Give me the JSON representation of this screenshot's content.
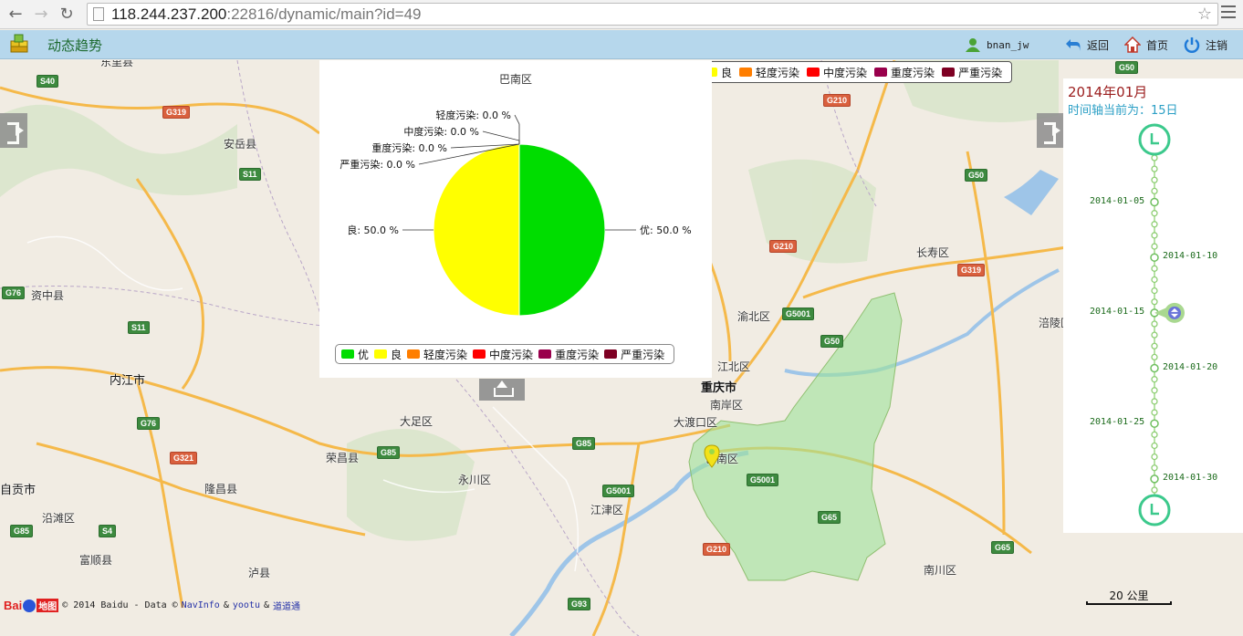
{
  "browser": {
    "url_host": "118.244.237.200",
    "url_rest": ":22816/dynamic/main?id=49"
  },
  "header": {
    "title": "动态趋势",
    "user": "bnan_jw",
    "back_label": "返回",
    "home_label": "首页",
    "logout_label": "注销"
  },
  "map": {
    "labels": [
      {
        "text": "东里县",
        "kind": "small"
      },
      {
        "text": "安岳县",
        "kind": "small"
      },
      {
        "text": "资中县",
        "kind": "small"
      },
      {
        "text": "内江市",
        "kind": "city"
      },
      {
        "text": "自贡市",
        "kind": "city"
      },
      {
        "text": "沿滩区",
        "kind": "small"
      },
      {
        "text": "富顺县",
        "kind": "small"
      },
      {
        "text": "隆昌县",
        "kind": "small"
      },
      {
        "text": "泸县",
        "kind": "small"
      },
      {
        "text": "大足区",
        "kind": "small"
      },
      {
        "text": "荣昌县",
        "kind": "small"
      },
      {
        "text": "永川区",
        "kind": "small"
      },
      {
        "text": "江津区",
        "kind": "small"
      },
      {
        "text": "渝北区",
        "kind": "small"
      },
      {
        "text": "江北区",
        "kind": "small"
      },
      {
        "text": "重庆市",
        "kind": "city"
      },
      {
        "text": "南岸区",
        "kind": "small"
      },
      {
        "text": "大渡口区",
        "kind": "small"
      },
      {
        "text": "巴南区",
        "kind": "small"
      },
      {
        "text": "长寿区",
        "kind": "small"
      },
      {
        "text": "涪陵区",
        "kind": "small"
      },
      {
        "text": "南川区",
        "kind": "small"
      }
    ],
    "shields": [
      "S40",
      "G319",
      "S11",
      "G76",
      "S11",
      "G76",
      "G321",
      "G85",
      "S4",
      "G85",
      "G85",
      "G5001",
      "G210",
      "G5001",
      "G50",
      "G210",
      "G50",
      "G319",
      "G5001",
      "G65",
      "G210",
      "G93",
      "G50",
      "G65"
    ],
    "copyright_prefix": "© 2014 Baidu - Data ©",
    "copyright_navinfo": "NavInfo",
    "copyright_yootu": "yootu",
    "copyright_daodao": "道道通",
    "baidu_brand": "Baidu地图",
    "scale_label": "20 公里"
  },
  "legend": {
    "items": [
      {
        "label": "优",
        "color": "#00dd00"
      },
      {
        "label": "良",
        "color": "#ffff00"
      },
      {
        "label": "轻度污染",
        "color": "#ff7e00"
      },
      {
        "label": "中度污染",
        "color": "#ff0000"
      },
      {
        "label": "重度污染",
        "color": "#99004c"
      },
      {
        "label": "严重污染",
        "color": "#7e0023"
      }
    ]
  },
  "chart_data": {
    "type": "pie",
    "title": "巴南区",
    "slices": [
      {
        "label": "优",
        "value": 50.0,
        "color": "#00dd00",
        "text": "优: 50.0 %"
      },
      {
        "label": "良",
        "value": 50.0,
        "color": "#ffff00",
        "text": "良: 50.0 %"
      },
      {
        "label": "轻度污染",
        "value": 0.0,
        "color": "#ff7e00",
        "text": "轻度污染: 0.0 %"
      },
      {
        "label": "中度污染",
        "value": 0.0,
        "color": "#ff0000",
        "text": "中度污染: 0.0 %"
      },
      {
        "label": "重度污染",
        "value": 0.0,
        "color": "#99004c",
        "text": "重度污染: 0.0 %"
      },
      {
        "label": "严重污染",
        "value": 0.0,
        "color": "#7e0023",
        "text": "严重污染: 0.0 %"
      }
    ],
    "legend_position": "bottom"
  },
  "timeline": {
    "month_title": "2014年01月",
    "current_label": "时间轴当前为：15日",
    "dates": [
      "2014-01-05",
      "2014-01-10",
      "2014-01-15",
      "2014-01-20",
      "2014-01-25",
      "2014-01-30"
    ],
    "current_index": 2,
    "day_count": 31
  }
}
